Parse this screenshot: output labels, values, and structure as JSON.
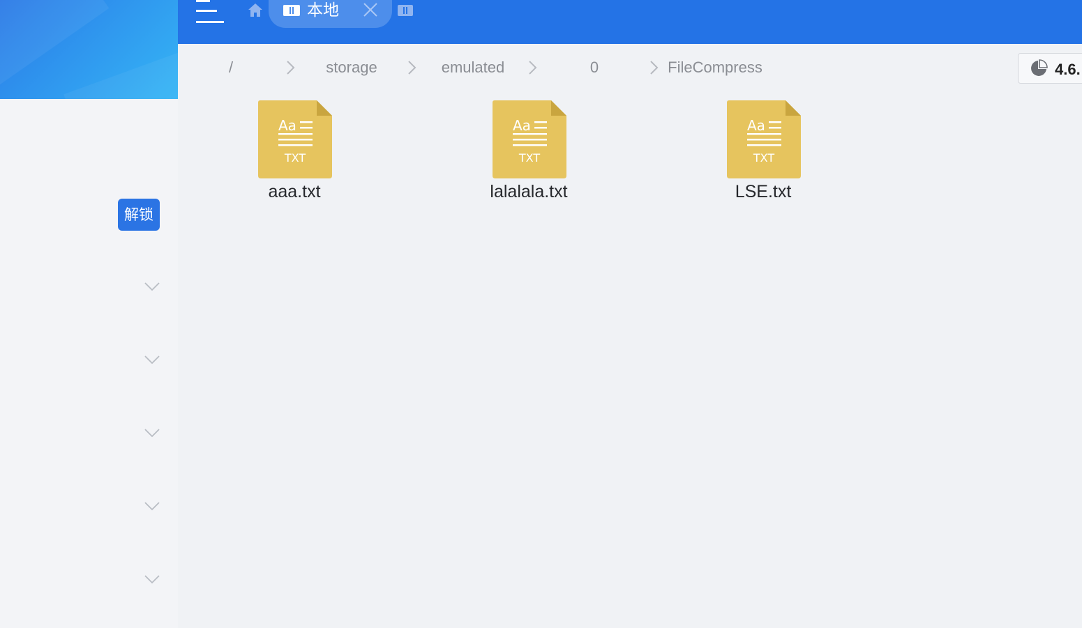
{
  "header": {
    "menu_icon": "menu-icon",
    "home_icon": "home-icon",
    "tabs": [
      {
        "label": "本地",
        "icon": "storage-icon",
        "close_icon": "close-icon"
      }
    ],
    "new_tab_icon": "storage-icon",
    "colors": {
      "header_bg": "#2473e6",
      "active_tab_bg": "#4d8eeb"
    }
  },
  "sidebar": {
    "unlock_label": "解锁",
    "chevron_icon": "chevron-down-icon",
    "colors": {
      "accent": "#2b74e4"
    }
  },
  "breadcrumb": {
    "items": [
      "/",
      "storage",
      "emulated",
      "0",
      "FileCompress"
    ],
    "separator_icon": "chevron-right-icon"
  },
  "storage": {
    "value_text": "4.6.",
    "icon": "pie-chart-icon"
  },
  "files": [
    {
      "name": "aaa.txt",
      "type": "TXT",
      "icon_text": "Aa"
    },
    {
      "name": "lalalala.txt",
      "type": "TXT",
      "icon_text": "Aa"
    },
    {
      "name": "LSE.txt",
      "type": "TXT",
      "icon_text": "Aa"
    }
  ],
  "colors": {
    "file_icon": "#e6c45e",
    "file_icon_fold": "#c9a53f"
  }
}
